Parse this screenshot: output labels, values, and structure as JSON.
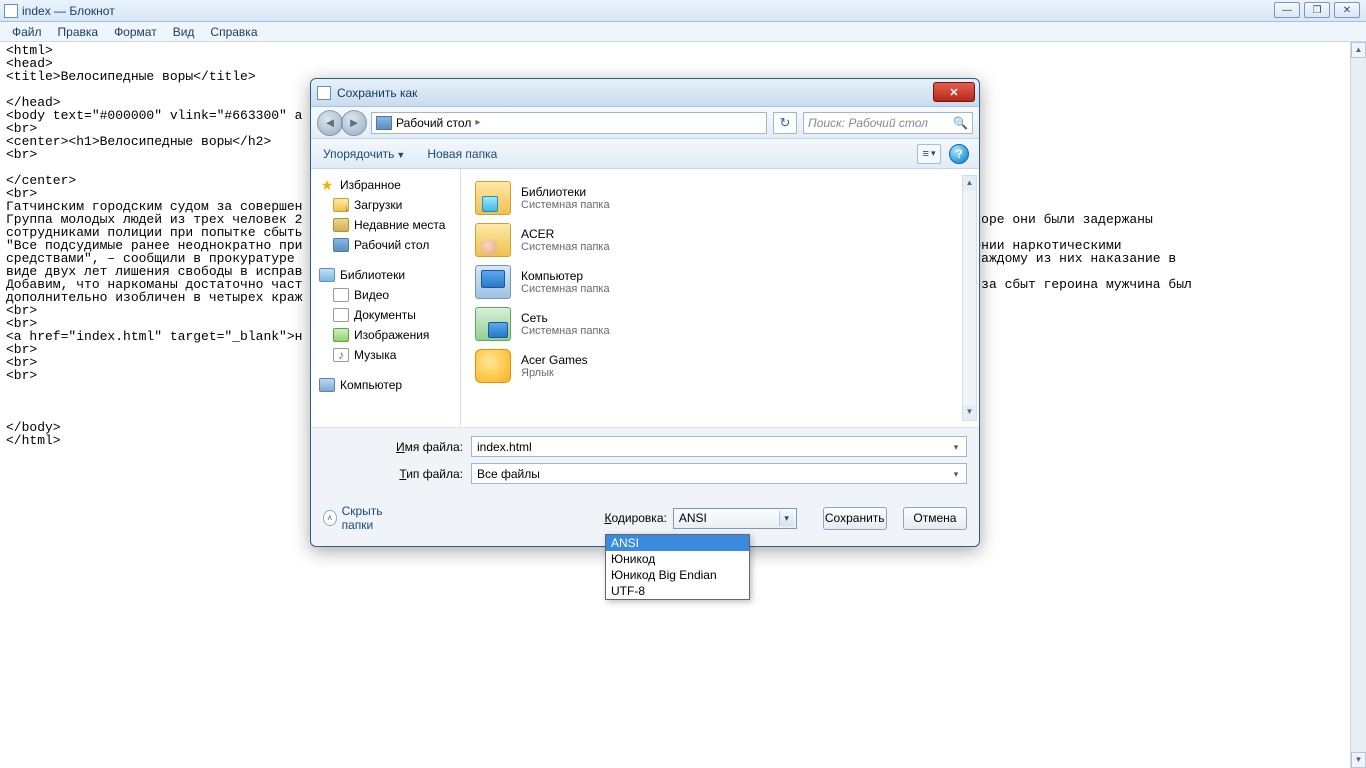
{
  "window": {
    "title": "index — Блокнот",
    "minimize": "—",
    "maximize": "❐",
    "close": "✕"
  },
  "menu": {
    "file": "Файл",
    "edit": "Правка",
    "format": "Формат",
    "view": "Вид",
    "help": "Справка"
  },
  "editor_text": "<html>\n<head>\n<title>Велосипедные воры</title>\n\n</head>\n<body text=\"#000000\" vlink=\"#663300\" a\n<br>\n<center><h1>Велосипедные воры</h2>\n<br>\n\n</center>\n<br>\nГатчинским городским судом за совершен                                                                       и.\nГруппа молодых людей из трех человек 2                                                                        \"Аэродром\". Вскоре они были задержаны\nсотрудниками полиции при попытке сбыть                                                                       евшему.\n\"Все подсудимые ранее неоднократно при                                                                       ы в злоупотреблении наркотическими\nсредствами\", – сообщили в прокуратуре                                                                         суд определил каждому из них наказание в\nвиде двух лет лишения свободы в исправ\nДобавим, что наркоманы достаточно част                                                                       ице задержанный за сбыт героина мужчина был\nдополнительно изобличен в четырех краж                                                                       имый мужчина.\n<br>\n<br>\n<a href=\"index.html\" target=\"_blank\">н\n<br>\n<br>\n<br>\n\n\n\n</body>\n</html>",
  "dialog": {
    "title": "Сохранить как",
    "breadcrumb": "Рабочий стол",
    "search_placeholder": "Поиск: Рабочий стол",
    "organize": "Упорядочить",
    "new_folder": "Новая папка",
    "sidebar": {
      "favorites": "Избранное",
      "downloads": "Загрузки",
      "recent": "Недавние места",
      "desktop": "Рабочий стол",
      "libraries": "Библиотеки",
      "video": "Видео",
      "documents": "Документы",
      "images": "Изображения",
      "music": "Музыка",
      "computer": "Компьютер"
    },
    "content": [
      {
        "title": "Библиотеки",
        "sub": "Системная папка"
      },
      {
        "title": "ACER",
        "sub": "Системная папка"
      },
      {
        "title": "Компьютер",
        "sub": "Системная папка"
      },
      {
        "title": "Сеть",
        "sub": "Системная папка"
      },
      {
        "title": "Acer Games",
        "sub": "Ярлык"
      }
    ],
    "filename_label": "Имя файла:",
    "filename_value": "index.html",
    "filetype_label": "Тип файла:",
    "filetype_value": "Все файлы",
    "hide_folders": "Скрыть папки",
    "encoding_label": "Кодировка:",
    "encoding_value": "ANSI",
    "encoding_options": [
      "ANSI",
      "Юникод",
      "Юникод Big Endian",
      "UTF-8"
    ],
    "save": "Сохранить",
    "cancel": "Отмена"
  }
}
